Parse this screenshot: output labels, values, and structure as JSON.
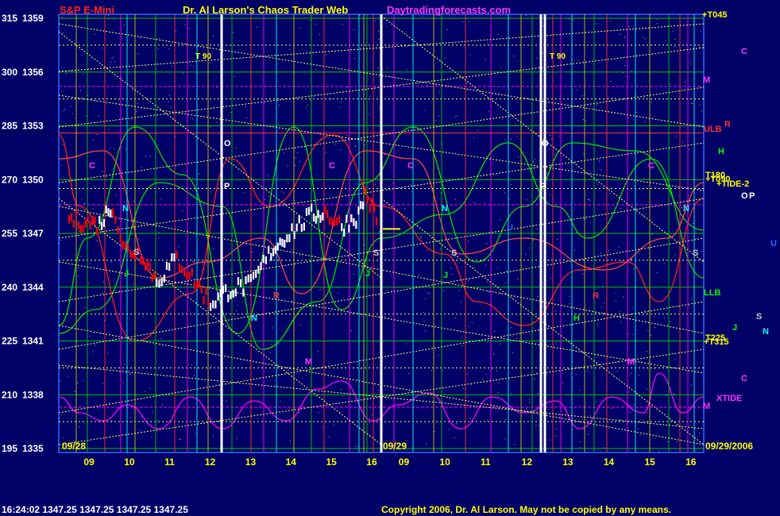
{
  "header": {
    "symbol": "S&P E-Mini",
    "title": "Dr. Al Larson's Chaos Trader Web",
    "site": "Daytradingforecasts.com"
  },
  "footer": {
    "quote": "16:24:02  1347.25  1347.25  1347.25  1347.25",
    "copyright": "Copyright 2006, Dr. Al Larson. May not be copied by any means."
  },
  "colors": {
    "background": "#000066",
    "price_up": "#ffffff",
    "price_down": "#ff0000",
    "grid_gold": "#c8c800",
    "grid_green": "#00c800",
    "diagonal": "#ffff66",
    "magenta_field": "#ff00ff",
    "red_field": "#ff2020",
    "green_field": "#00dd00"
  },
  "chart_data": {
    "type": "line",
    "y_left_labels": [
      "315",
      "300",
      "285",
      "270",
      "255",
      "240",
      "225",
      "210",
      "195"
    ],
    "y_right_labels": [
      "1359",
      "1356",
      "1353",
      "1350",
      "1347",
      "1344",
      "1341",
      "1338",
      "1335"
    ],
    "ylim": [
      1335,
      1359
    ],
    "x_ticks": [
      "09",
      "10",
      "11",
      "12",
      "13",
      "14",
      "15",
      "16",
      "09",
      "10",
      "11",
      "12",
      "13",
      "14",
      "15",
      "16"
    ],
    "date_labels": [
      "09/28",
      "09/29",
      "09/29/2006"
    ],
    "series": [
      {
        "name": "S&P E-Mini",
        "color": "#ffffff",
        "values": [
          {
            "t": "09/28 08:30",
            "y": 1347.8
          },
          {
            "t": "09/28 09:15",
            "y": 1347.5
          },
          {
            "t": "09/28 09:35",
            "y": 1348.6
          },
          {
            "t": "09/28 09:50",
            "y": 1346.2
          },
          {
            "t": "09/28 10:20",
            "y": 1345.8
          },
          {
            "t": "09/28 10:40",
            "y": 1344.3
          },
          {
            "t": "09/28 11:10",
            "y": 1345.6
          },
          {
            "t": "09/28 11:40",
            "y": 1344.2
          },
          {
            "t": "09/28 12:00",
            "y": 1343.1
          },
          {
            "t": "09/28 12:30",
            "y": 1343.9
          },
          {
            "t": "09/28 13:00",
            "y": 1344.1
          },
          {
            "t": "09/28 13:30",
            "y": 1346.0
          },
          {
            "t": "09/28 13:50",
            "y": 1346.8
          },
          {
            "t": "09/28 14:30",
            "y": 1348.0
          },
          {
            "t": "09/28 14:50",
            "y": 1348.2
          },
          {
            "t": "09/28 15:15",
            "y": 1347.4
          },
          {
            "t": "09/28 15:40",
            "y": 1348.0
          },
          {
            "t": "09/28 15:50",
            "y": 1349.2
          },
          {
            "t": "09/28 16:10",
            "y": 1347.6
          },
          {
            "t": "09/29 08:30",
            "y": 1347.25
          }
        ]
      }
    ],
    "line_labels_right": [
      "+T045",
      "T180",
      "+T090",
      "+TIDE-2",
      "ULB",
      "LLB",
      "+T315",
      "T225",
      "XTIDE"
    ],
    "planet_labels": [
      "C",
      "M",
      "R",
      "H",
      "J",
      "S",
      "N",
      "O",
      "P",
      "U"
    ],
    "vertical_markers": [
      "T 90",
      "T 90"
    ]
  }
}
